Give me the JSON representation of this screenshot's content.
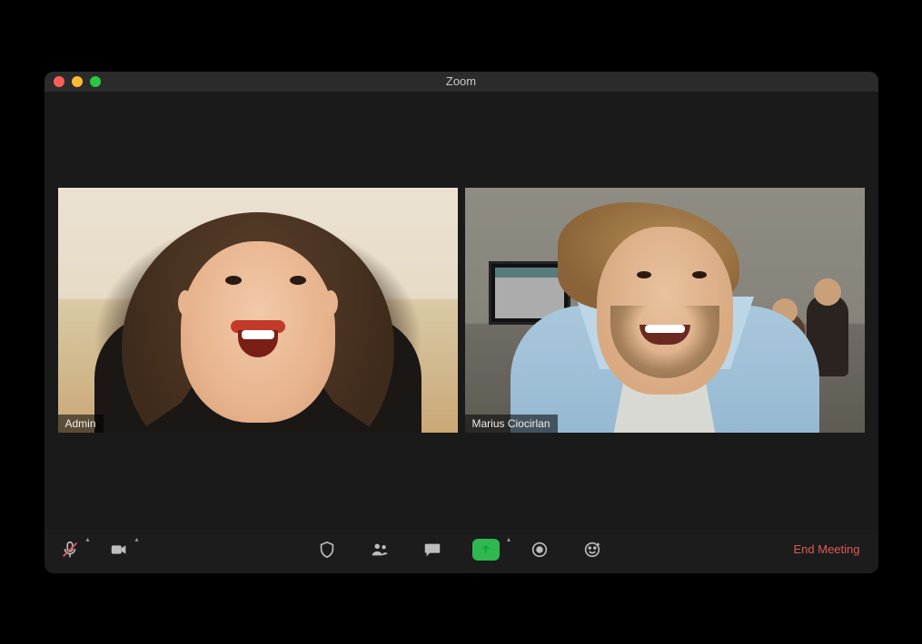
{
  "window": {
    "title": "Zoom"
  },
  "participants": [
    {
      "name": "Admin",
      "active": true
    },
    {
      "name": "Marius Ciocirlan",
      "active": false
    }
  ],
  "toolbar": {
    "mute": {
      "icon": "microphone-muted-icon"
    },
    "video": {
      "icon": "video-icon"
    },
    "security": {
      "icon": "shield-icon"
    },
    "participants": {
      "icon": "participants-icon"
    },
    "chat": {
      "icon": "chat-icon"
    },
    "share": {
      "icon": "share-screen-icon"
    },
    "record": {
      "icon": "record-icon"
    },
    "reactions": {
      "icon": "reactions-icon"
    },
    "end_label": "End Meeting"
  },
  "colors": {
    "active_border": "#b6e61d",
    "share_green": "#2fb84f",
    "end_red": "#e05a5a"
  }
}
